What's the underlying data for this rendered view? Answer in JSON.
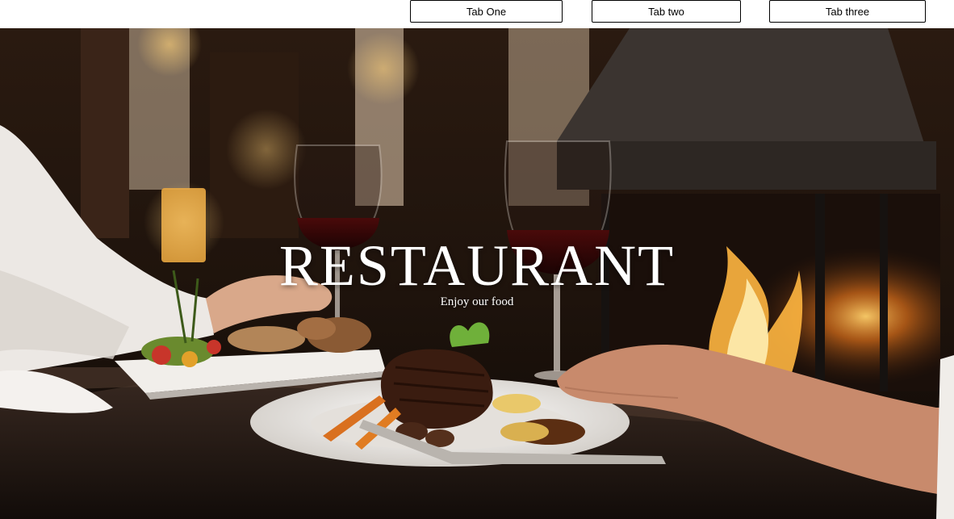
{
  "tabs": [
    {
      "label": "Tab One"
    },
    {
      "label": "Tab two"
    },
    {
      "label": "Tab three"
    }
  ],
  "hero": {
    "title": "RESTAURANT",
    "subtitle": "Enjoy our food",
    "image_subject": "restaurant-dinner-photo"
  }
}
